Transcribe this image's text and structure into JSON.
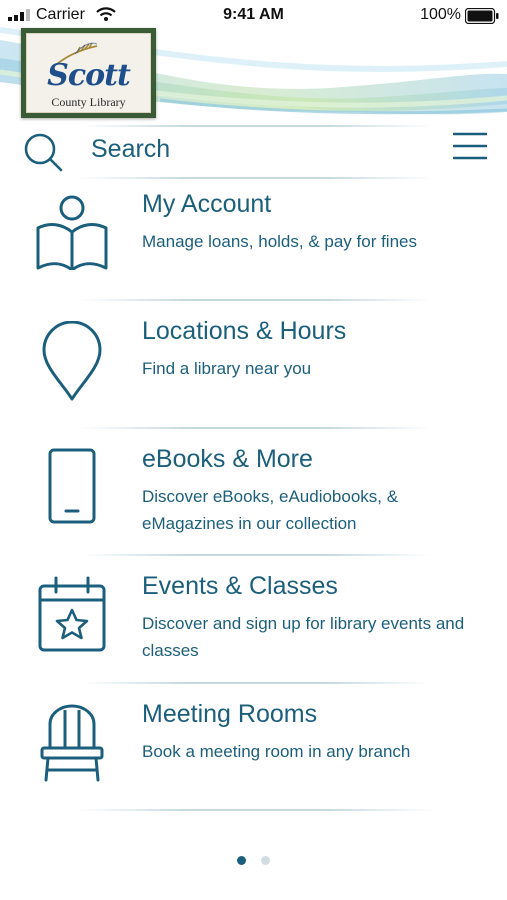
{
  "status_bar": {
    "carrier": "Carrier",
    "time": "9:41 AM",
    "battery": "100%"
  },
  "logo": {
    "name": "Scott",
    "subtitle": "County Library"
  },
  "search": {
    "label": "Search"
  },
  "menu": {
    "items": [
      {
        "title": "My Account",
        "description": "Manage loans, holds, & pay for fines",
        "icon": "reader-icon"
      },
      {
        "title": "Locations & Hours",
        "description": "Find a library near you",
        "icon": "location-pin-icon"
      },
      {
        "title": "eBooks & More",
        "description": "Discover eBooks, eAudiobooks, & eMagazines in our collection",
        "icon": "tablet-icon"
      },
      {
        "title": "Events & Classes",
        "description": "Discover and sign up for library events and classes",
        "icon": "calendar-star-icon"
      },
      {
        "title": "Meeting Rooms",
        "description": "Book a meeting room in any branch",
        "icon": "chair-icon"
      }
    ]
  },
  "pagination": {
    "current": 1,
    "total": 2
  },
  "colors": {
    "accent": "#1c5f7d",
    "logo_frame": "#3b5a36",
    "logo_text": "#1f4f8a"
  }
}
